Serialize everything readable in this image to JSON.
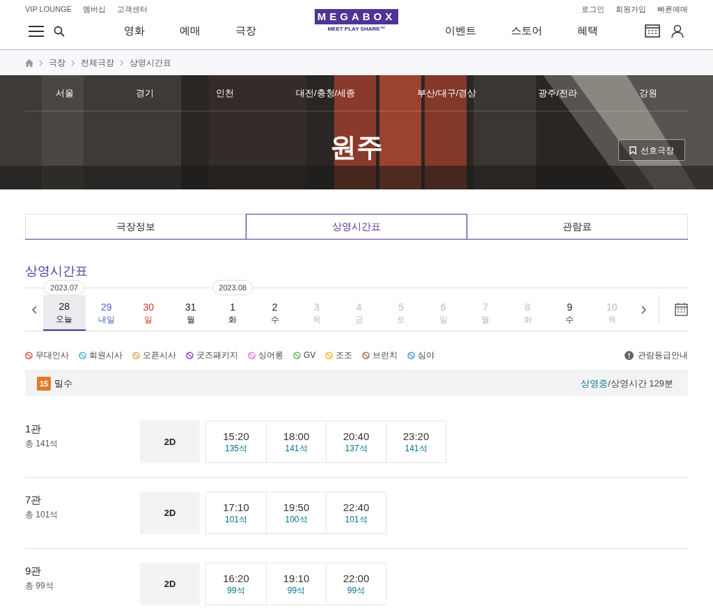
{
  "top_links_left": [
    "VIP LOUNGE",
    "멤버십",
    "고객센터"
  ],
  "top_links_right": [
    "로그인",
    "회원가입",
    "빠른예매"
  ],
  "logo": {
    "name": "MEGABOX",
    "tagline": "MEET PLAY SHARE™"
  },
  "nav_left": [
    "영화",
    "예매",
    "극장"
  ],
  "nav_right": [
    "이벤트",
    "스토어",
    "혜택"
  ],
  "breadcrumb": [
    "극장",
    "전체극장",
    "상영시간표"
  ],
  "regions": [
    "서울",
    "경기",
    "인천",
    "대전/충청/세종",
    "부산/대구/경상",
    "광주/전라",
    "강원"
  ],
  "theater_name": "원주",
  "favorite_button": "선호극장",
  "tabs": [
    {
      "label": "극장정보",
      "selected": false
    },
    {
      "label": "상영시간표",
      "selected": true
    },
    {
      "label": "관람료",
      "selected": false
    }
  ],
  "section_title": "상영시간표",
  "dates": [
    {
      "month": "2023.07",
      "day": "28",
      "weekday": "오늘",
      "kind": "normal",
      "selected": true,
      "disabled": false
    },
    {
      "day": "29",
      "weekday": "내일",
      "kind": "tomorrow",
      "selected": false,
      "disabled": false
    },
    {
      "day": "30",
      "weekday": "일",
      "kind": "sunday",
      "selected": false,
      "disabled": false
    },
    {
      "day": "31",
      "weekday": "월",
      "kind": "normal",
      "selected": false,
      "disabled": false
    },
    {
      "month": "2023.08",
      "day": "1",
      "weekday": "화",
      "kind": "normal",
      "selected": false,
      "disabled": false
    },
    {
      "day": "2",
      "weekday": "수",
      "kind": "normal",
      "selected": false,
      "disabled": false
    },
    {
      "day": "3",
      "weekday": "목",
      "kind": "normal",
      "selected": false,
      "disabled": true
    },
    {
      "day": "4",
      "weekday": "금",
      "kind": "normal",
      "selected": false,
      "disabled": true
    },
    {
      "day": "5",
      "weekday": "토",
      "kind": "normal",
      "selected": false,
      "disabled": true
    },
    {
      "day": "6",
      "weekday": "일",
      "kind": "normal",
      "selected": false,
      "disabled": true
    },
    {
      "day": "7",
      "weekday": "월",
      "kind": "normal",
      "selected": false,
      "disabled": true
    },
    {
      "day": "8",
      "weekday": "화",
      "kind": "normal",
      "selected": false,
      "disabled": true
    },
    {
      "day": "9",
      "weekday": "수",
      "kind": "normal",
      "selected": false,
      "disabled": false
    },
    {
      "day": "10",
      "weekday": "목",
      "kind": "normal",
      "selected": false,
      "disabled": true
    }
  ],
  "legend": [
    {
      "label": "무대인사",
      "color": "#e94a4a"
    },
    {
      "label": "회원시사",
      "color": "#4ab5c4"
    },
    {
      "label": "오픈시사",
      "color": "#d9a64a"
    },
    {
      "label": "굿즈패키지",
      "color": "#8a4ad9"
    },
    {
      "label": "싱어롱",
      "color": "#e07ad0"
    },
    {
      "label": "GV",
      "color": "#6ab56a"
    },
    {
      "label": "조조",
      "color": "#f0b030"
    },
    {
      "label": "브런치",
      "color": "#a0704a"
    },
    {
      "label": "심야",
      "color": "#3a9ad9"
    }
  ],
  "rating_guide": "관람등급안내",
  "movie": {
    "rating": "15",
    "title": "밀수",
    "status": "상영중",
    "runtime": "/상영시간 129분"
  },
  "screens": [
    {
      "name": "1관",
      "total": "총 141석",
      "format": "2D",
      "times": [
        {
          "time": "15:20",
          "seats": "135석"
        },
        {
          "time": "18:00",
          "seats": "141석"
        },
        {
          "time": "20:40",
          "seats": "137석"
        },
        {
          "time": "23:20",
          "seats": "141석"
        }
      ]
    },
    {
      "name": "7관",
      "total": "총 101석",
      "format": "2D",
      "times": [
        {
          "time": "17:10",
          "seats": "101석"
        },
        {
          "time": "19:50",
          "seats": "100석"
        },
        {
          "time": "22:40",
          "seats": "101석"
        }
      ]
    },
    {
      "name": "9관",
      "total": "총 99석",
      "format": "2D",
      "times": [
        {
          "time": "16:20",
          "seats": "99석"
        },
        {
          "time": "19:10",
          "seats": "99석"
        },
        {
          "time": "22:00",
          "seats": "99석"
        }
      ]
    }
  ]
}
